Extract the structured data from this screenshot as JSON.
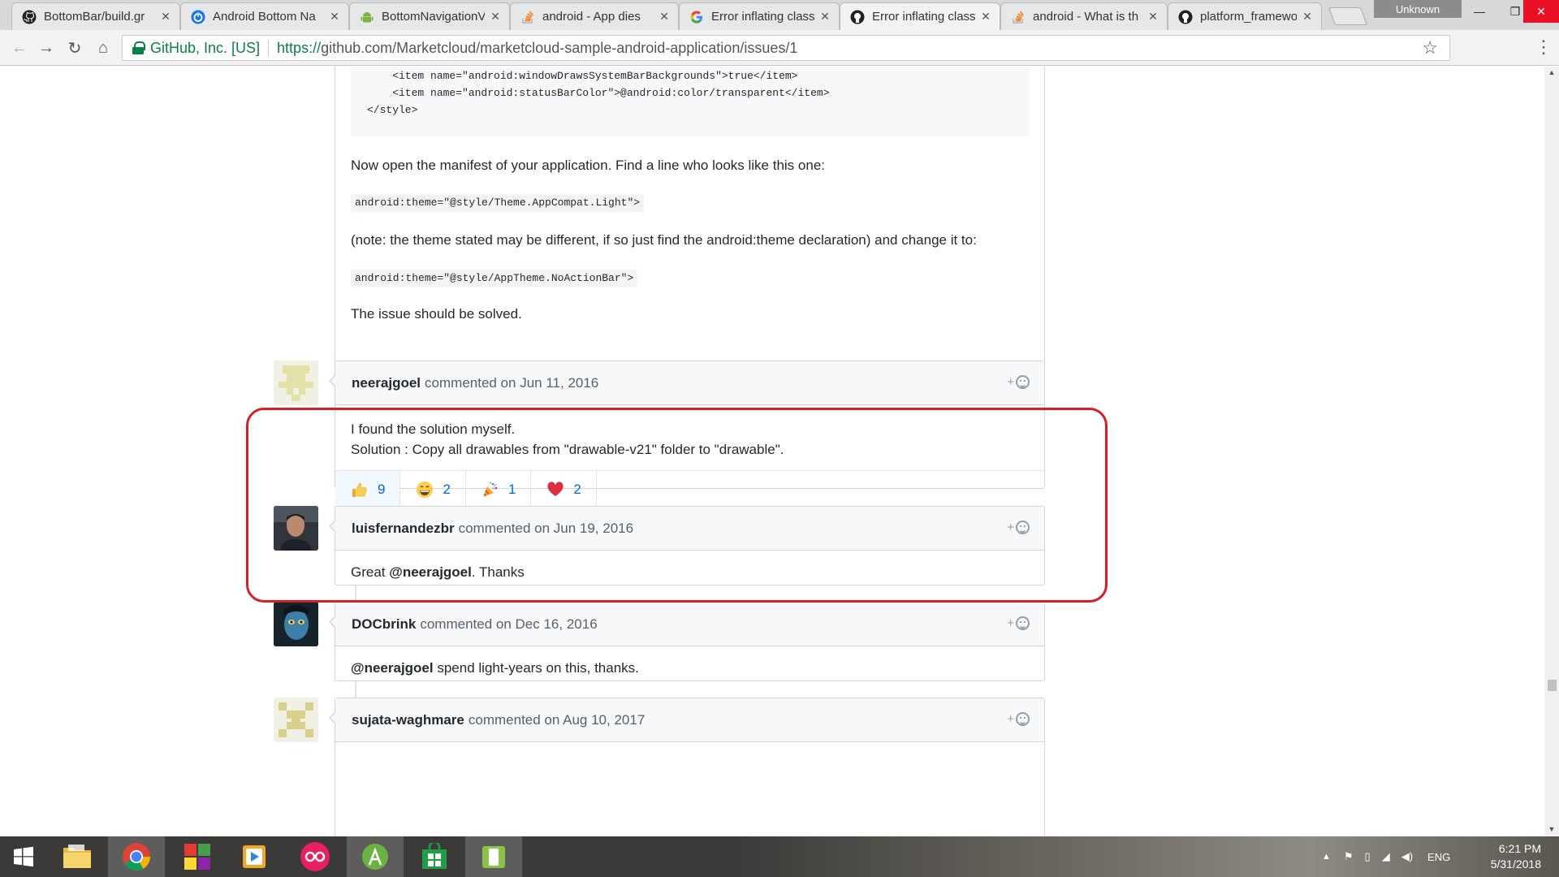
{
  "browser": {
    "tabs": [
      {
        "title": "BottomBar/build.gr",
        "favicon": "github-icon"
      },
      {
        "title": "Android Bottom Na",
        "favicon": "power-icon"
      },
      {
        "title": "BottomNavigationV",
        "favicon": "android-icon"
      },
      {
        "title": "android - App dies",
        "favicon": "stackoverflow-icon"
      },
      {
        "title": "Error inflating class",
        "favicon": "google-icon"
      },
      {
        "title": "Error inflating class",
        "favicon": "github-icon"
      },
      {
        "title": "android - What is th",
        "favicon": "stackoverflow-icon"
      },
      {
        "title": "platform_framewor",
        "favicon": "github-icon"
      }
    ],
    "profile_label": "Unknown",
    "cert_name": "GitHub, Inc. [US]",
    "url_scheme": "https://",
    "url_rest": "github.com/Marketcloud/marketcloud-sample-android-application/issues/1"
  },
  "prev_comment": {
    "code_lines": [
      "    <item name=\"android:windowDrawsSystemBarBackgrounds\">true</item>",
      "    <item name=\"android:statusBarColor\">@android:color/transparent</item>",
      "</style>"
    ],
    "para1": "Now open the manifest of your application. Find a line who looks like this one:",
    "code1": "android:theme=\"@style/Theme.AppCompat.Light\">",
    "para2": "(note: the theme stated may be different, if so just find the android:theme declaration) and change it to:",
    "code2": "android:theme=\"@style/AppTheme.NoActionBar\">",
    "para3": "The issue should be solved."
  },
  "comments": [
    {
      "author": "neerajgoel",
      "meta": "commented on Jun 11, 2016",
      "lines": [
        "I found the solution myself.",
        "Solution : Copy all drawables from \"drawable-v21\" folder to \"drawable\"."
      ],
      "reactions": [
        {
          "emoji": "thumbs-up-icon",
          "glyph": "👍",
          "count": "9"
        },
        {
          "emoji": "laugh-icon",
          "glyph": "😄",
          "count": "2"
        },
        {
          "emoji": "hooray-icon",
          "glyph": "🎉",
          "count": "1"
        },
        {
          "emoji": "heart-icon",
          "glyph": "❤",
          "count": "2"
        }
      ]
    },
    {
      "author": "luisfernandezbr",
      "meta": "commented on Jun 19, 2016",
      "body_prefix": "Great ",
      "mention": "@neerajgoel",
      "body_suffix": ". Thanks"
    },
    {
      "author": "DOCbrink",
      "meta": "commented on Dec 16, 2016",
      "mention": "@neerajgoel",
      "body_suffix": " spend light-years on this, thanks."
    },
    {
      "author": "sujata-waghmare",
      "meta": "commented on Aug 10, 2017"
    }
  ],
  "add_reaction_label": "+",
  "taskbar": {
    "lang": "ENG",
    "time": "6:21 PM",
    "date": "5/31/2018"
  },
  "colors": {
    "highlight": "#d71d25",
    "link": "#0366d6"
  }
}
